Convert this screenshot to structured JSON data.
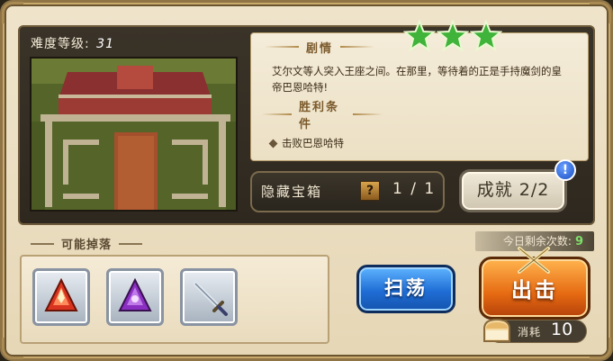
{
  "stage": {
    "difficulty_label": "难度等级:",
    "difficulty_value": "31",
    "stars_earned": 3,
    "stars_total": 3,
    "star_color": "#3fb33a"
  },
  "story": {
    "heading": "剧情",
    "text": "艾尔文等人突入王座之间。在那里，等待着的正是手持魔剑的皇帝巴恩哈特!",
    "victory_heading": "胜利条件",
    "victory_condition": "击败巴恩哈特"
  },
  "chest": {
    "label": "隐藏宝箱",
    "icon": "question-chest-icon",
    "count": "1 / 1"
  },
  "achievement": {
    "label": "成就 2/2",
    "alert": "!"
  },
  "drops": {
    "title": "可能掉落",
    "items": [
      {
        "name": "red-crystal-icon",
        "color": "#d8341f"
      },
      {
        "name": "purple-crystal-icon",
        "color": "#8a2fc2"
      },
      {
        "name": "sword-icon",
        "color": "#7c8b9b"
      }
    ]
  },
  "remaining": {
    "label": "今日剩余次数:",
    "value": "9"
  },
  "actions": {
    "sweep_label": "扫荡",
    "sortie_label": "出击",
    "cost_label": "消耗",
    "cost_value": "10"
  }
}
